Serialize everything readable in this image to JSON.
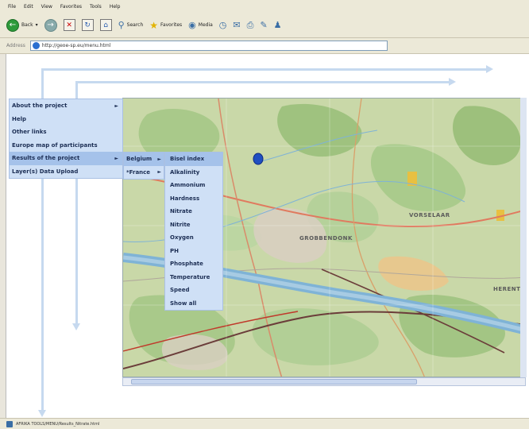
{
  "browser": {
    "menu": [
      "File",
      "Edit",
      "View",
      "Favorites",
      "Tools",
      "Help"
    ],
    "toolbar": {
      "back": "Back",
      "search": "Search",
      "favorites": "Favorites",
      "media": "Media"
    },
    "address_label": "Address",
    "url": "http://geoe-sp.eu/menu.html",
    "status_text": "AFRIKA TOOLS/MENU/Results_Nitrate.html"
  },
  "menu": {
    "items": [
      {
        "label": "About the project",
        "has_submenu": true
      },
      {
        "label": "Help",
        "has_submenu": false
      },
      {
        "label": "Other links",
        "has_submenu": false
      },
      {
        "label": "Europe map of participants",
        "has_submenu": false
      },
      {
        "label": "Results of the project",
        "has_submenu": true,
        "active": true
      },
      {
        "label": "Layer(s) Data Upload",
        "has_submenu": false
      }
    ],
    "countries": [
      {
        "label": "Belgium",
        "active": true
      },
      {
        "label": "*France",
        "active": false
      }
    ],
    "parameters": [
      "Bisel index",
      "Alkalinity",
      "Ammonium",
      "Hardness",
      "Nitrate",
      "Nitrite",
      "Oxygen",
      "PH",
      "Phosphate",
      "Temperature",
      "Speed",
      "Show all"
    ]
  },
  "map": {
    "place_labels": [
      "GROBBENDONK",
      "VORSELAAR",
      "HERENT"
    ]
  },
  "colors": {
    "menu_bg": "#cfe0f6",
    "menu_active": "#a5c2ea",
    "menu_text": "#1c2e54",
    "canal": "#7fb3d6"
  }
}
